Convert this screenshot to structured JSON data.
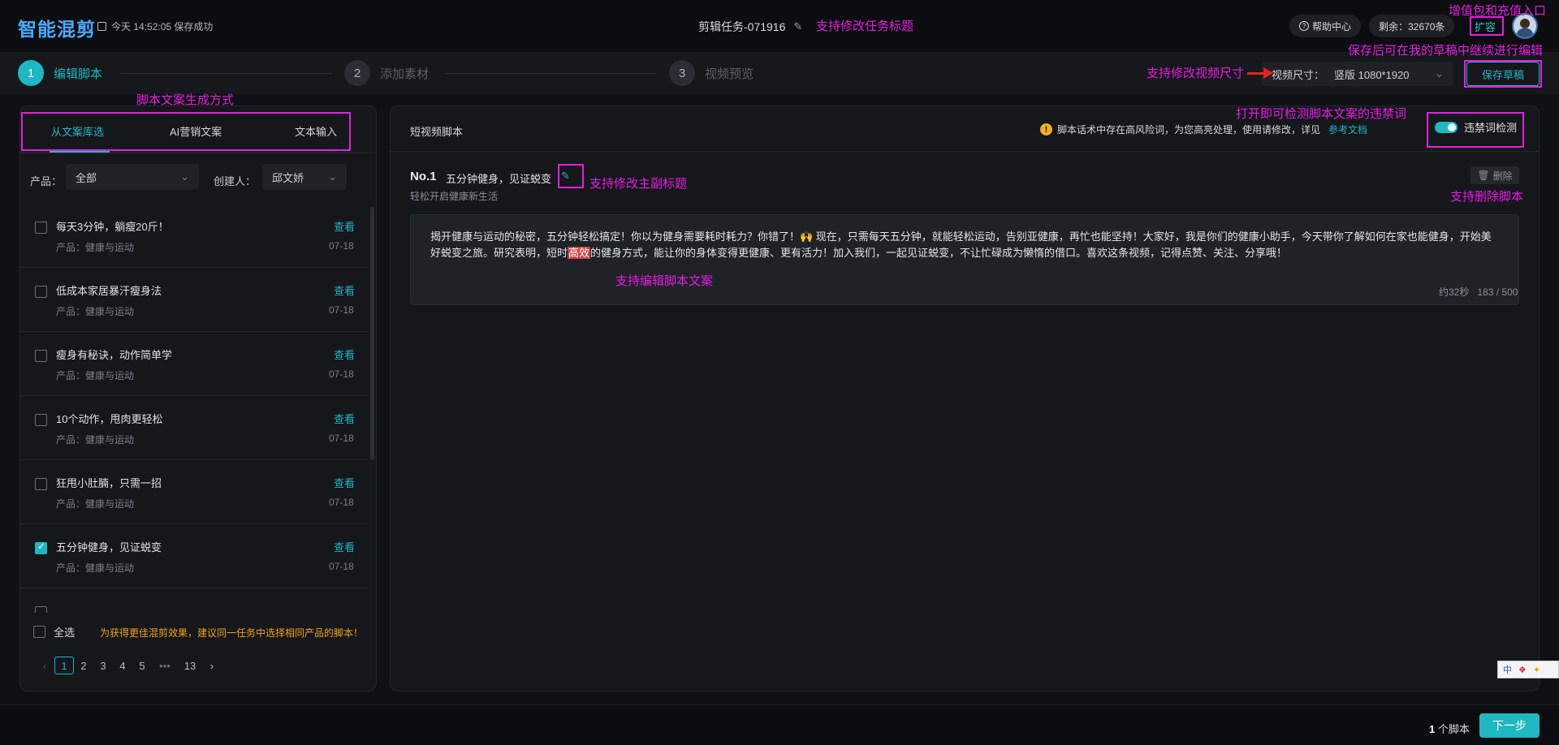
{
  "header": {
    "logo": "智能混剪",
    "save_status": "今天 14:52:05 保存成功",
    "task_title": "剪辑任务-071916",
    "help": "帮助中心",
    "balance": "剩余：32670条",
    "expand": "扩容"
  },
  "steps": [
    {
      "num": "1",
      "label": "编辑脚本"
    },
    {
      "num": "2",
      "label": "添加素材"
    },
    {
      "num": "3",
      "label": "视频预览"
    }
  ],
  "video_size": {
    "label": "视频尺寸：",
    "value": "竖版 1080*1920"
  },
  "save_draft": "保存草稿",
  "left": {
    "tabs": [
      "从文案库选",
      "AI营销文案",
      "文本输入"
    ],
    "product_label": "产品：",
    "product_value": "全部",
    "creator_label": "创建人：",
    "creator_value": "邱文娇",
    "view": "查看",
    "items": [
      {
        "title": "每天3分钟，躺瘦20斤！",
        "sub": "产品：健康与运动",
        "date": "07-18",
        "checked": false
      },
      {
        "title": "低成本家居暴汗瘦身法",
        "sub": "产品：健康与运动",
        "date": "07-18",
        "checked": false
      },
      {
        "title": "瘦身有秘诀，动作简单学",
        "sub": "产品：健康与运动",
        "date": "07-18",
        "checked": false
      },
      {
        "title": "10个动作，甩肉更轻松",
        "sub": "产品：健康与运动",
        "date": "07-18",
        "checked": false
      },
      {
        "title": "狂甩小肚腩，只需一招",
        "sub": "产品：健康与运动",
        "date": "07-18",
        "checked": false
      },
      {
        "title": "五分钟健身，见证蜕变",
        "sub": "产品：健康与运动",
        "date": "07-18",
        "checked": true
      }
    ],
    "select_all": "全选",
    "hint": "为获得更佳混剪效果，建议同一任务中选择相同产品的脚本！",
    "pages": [
      "1",
      "2",
      "3",
      "4",
      "5",
      "•••",
      "13"
    ]
  },
  "right": {
    "title": "短视频脚本",
    "warning": "脚本话术中存在高风险词，为您高亮处理，使用请修改，详见",
    "ref_doc": "参考文档",
    "toggle_label": "违禁词检测",
    "no": "No.1",
    "main_title": "五分钟健身，见证蜕变",
    "sub_title": "轻松开启健康新生活",
    "delete": "删除",
    "text_before": "揭开健康与运动的秘密，五分钟轻松搞定！你以为健身需要耗时耗力？你错了！🙌 现在，只需每天五分钟，就能轻松运动，告别亚健康，再忙也能坚持！大家好，我是你们的健康小助手，今天带你了解如何在家也能健身，开始美好蜕变之旅。研究表明，短时",
    "text_highlight": "高效",
    "text_after": "的健身方式，能让你的身体变得更健康、更有活力！加入我们，一起见证蜕变，不让忙碌成为懒惰的借口。喜欢这条视频，记得点赞、关注、分享哦！",
    "duration": "约32秒",
    "count": "183 / 500"
  },
  "footer": {
    "count_num": "1",
    "count_label": " 个脚本",
    "next": "下一步"
  },
  "ime": {
    "lang": "中"
  },
  "annotations": {
    "topup": "增值包和充值入口",
    "draft_note": "保存后可在我的草稿中继续进行编辑",
    "task_title": "支持修改任务标题",
    "video_size": "支持修改视频尺寸",
    "gen_method": "脚本文案生成方式",
    "detect": "打开即可检测脚本文案的违禁词",
    "edit_title": "支持修改主副标题",
    "delete": "支持删除脚本",
    "edit_text": "支持编辑脚本文案"
  },
  "colors": {
    "accent": "#1eb7c2",
    "annotation": "#e51ee0",
    "warning": "#f3b21c",
    "highlight": "#c94545"
  }
}
